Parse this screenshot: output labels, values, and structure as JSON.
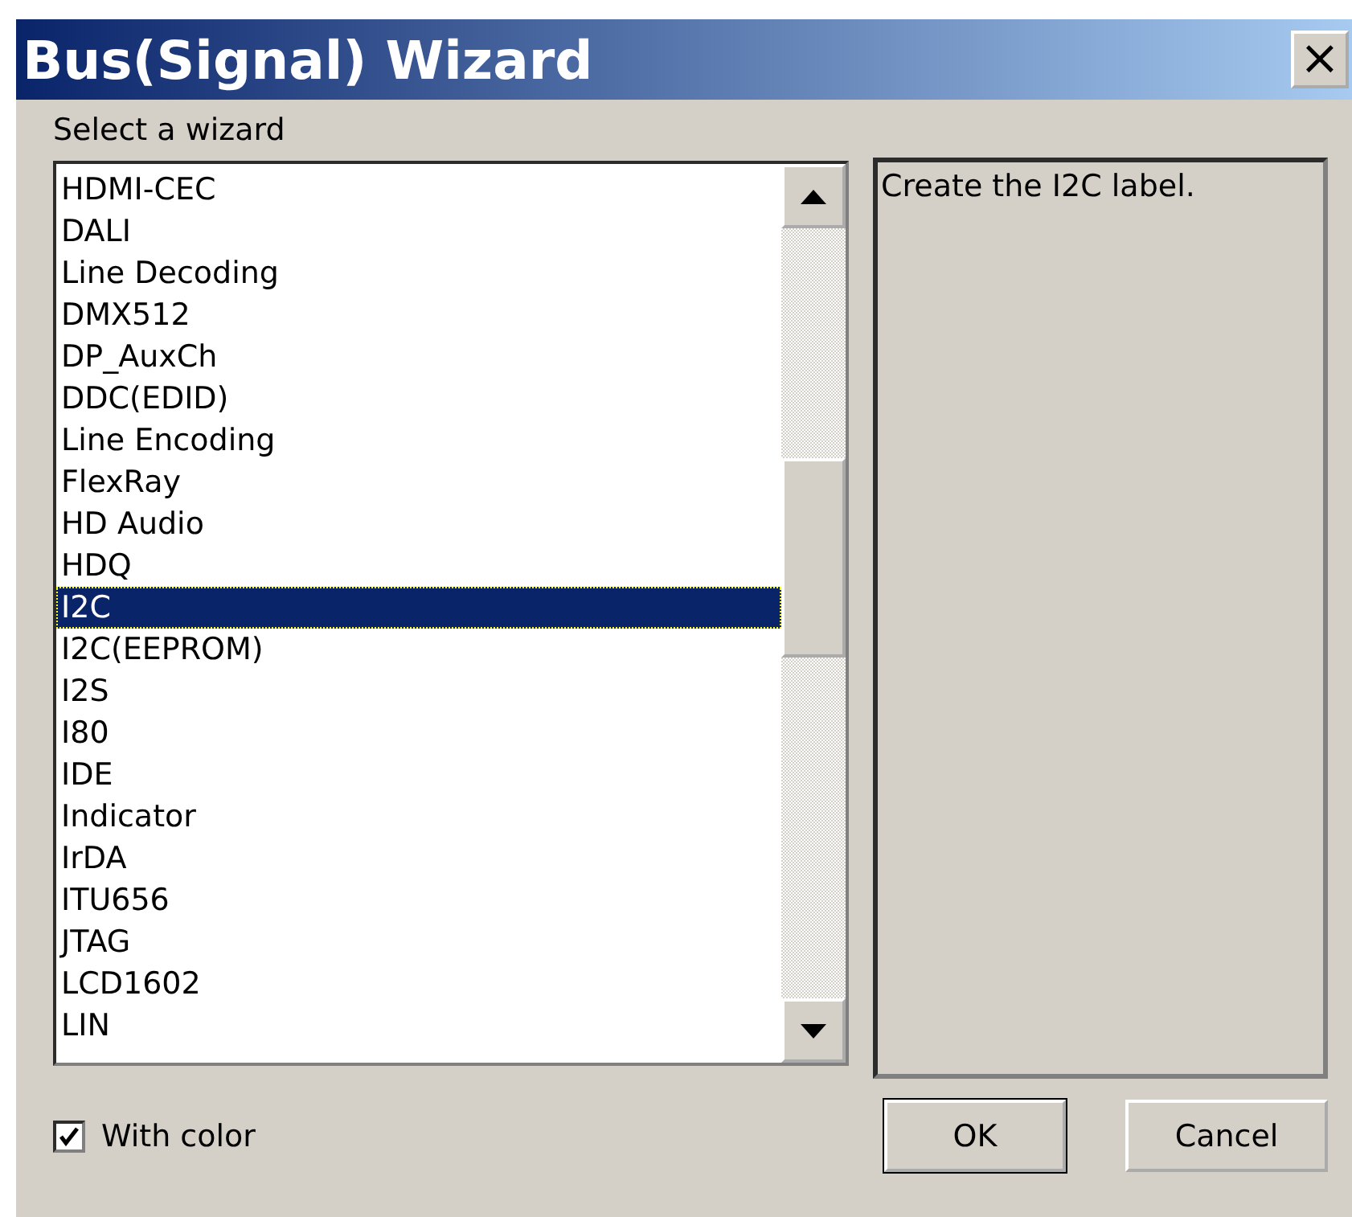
{
  "window": {
    "title": "Bus(Signal) Wizard",
    "close": "×"
  },
  "prompt": "Select a wizard",
  "wizards": [
    {
      "label": "HDMI-CEC",
      "selected": false
    },
    {
      "label": "DALI",
      "selected": false
    },
    {
      "label": "Line Decoding",
      "selected": false
    },
    {
      "label": "DMX512",
      "selected": false
    },
    {
      "label": "DP_AuxCh",
      "selected": false
    },
    {
      "label": "DDC(EDID)",
      "selected": false
    },
    {
      "label": "Line Encoding",
      "selected": false
    },
    {
      "label": "FlexRay",
      "selected": false
    },
    {
      "label": "HD Audio",
      "selected": false
    },
    {
      "label": "HDQ",
      "selected": false
    },
    {
      "label": "I2C",
      "selected": true
    },
    {
      "label": "I2C(EEPROM)",
      "selected": false
    },
    {
      "label": "I2S",
      "selected": false
    },
    {
      "label": "I80",
      "selected": false
    },
    {
      "label": "IDE",
      "selected": false
    },
    {
      "label": "Indicator",
      "selected": false
    },
    {
      "label": "IrDA",
      "selected": false
    },
    {
      "label": "ITU656",
      "selected": false
    },
    {
      "label": "JTAG",
      "selected": false
    },
    {
      "label": "LCD1602",
      "selected": false
    },
    {
      "label": "LIN",
      "selected": false
    }
  ],
  "description": "Create the I2C label.",
  "with_color": {
    "label": "With color",
    "checked": true
  },
  "buttons": [
    "OK",
    "Cancel"
  ]
}
